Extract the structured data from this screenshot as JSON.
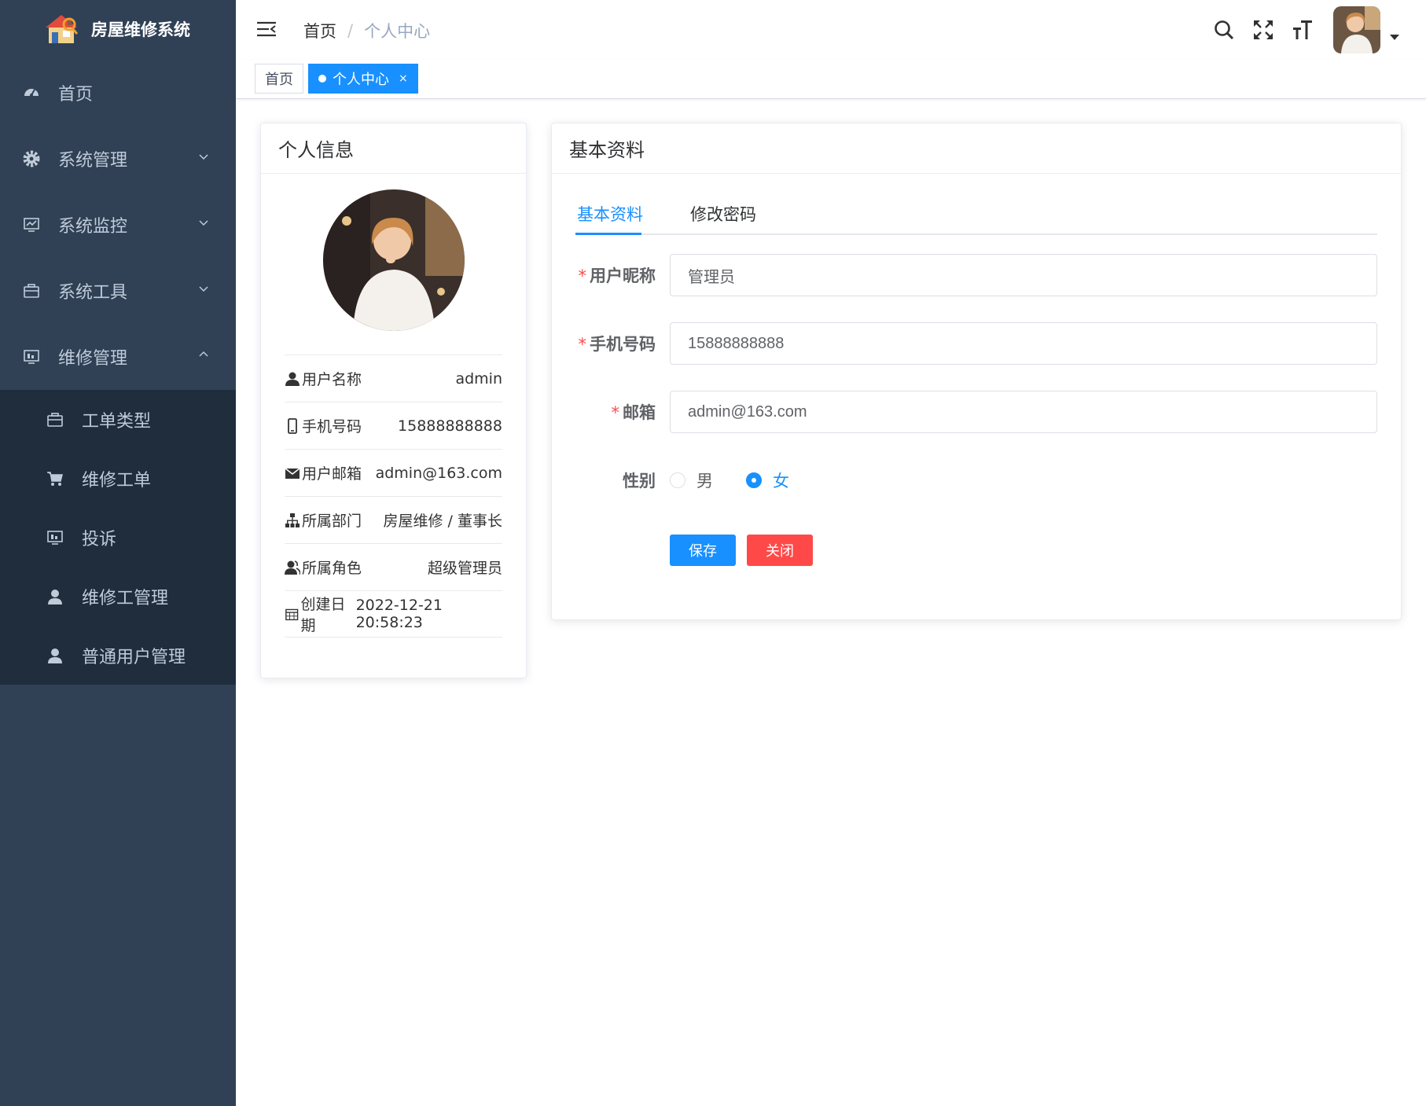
{
  "app": {
    "title": "房屋维修系统"
  },
  "sidebar": {
    "items": [
      {
        "label": "首页",
        "icon": "dashboard-icon"
      },
      {
        "label": "系统管理",
        "icon": "gear-icon"
      },
      {
        "label": "系统监控",
        "icon": "monitor-icon"
      },
      {
        "label": "系统工具",
        "icon": "toolbox-icon"
      },
      {
        "label": "维修管理",
        "icon": "monitor-icon"
      }
    ],
    "sub_items": [
      {
        "label": "工单类型",
        "icon": "toolbox-icon"
      },
      {
        "label": "维修工单",
        "icon": "cart-icon"
      },
      {
        "label": "投诉",
        "icon": "monitor-icon"
      },
      {
        "label": "维修工管理",
        "icon": "user-icon"
      },
      {
        "label": "普通用户管理",
        "icon": "user-icon"
      }
    ]
  },
  "header": {
    "breadcrumb": [
      "首页",
      "个人中心"
    ],
    "separator": "/"
  },
  "tags": {
    "home": "首页",
    "current": "个人中心",
    "close": "×"
  },
  "profile_card": {
    "title": "个人信息",
    "rows": [
      {
        "label": "用户名称",
        "value": "admin"
      },
      {
        "label": "手机号码",
        "value": "15888888888"
      },
      {
        "label": "用户邮箱",
        "value": "admin@163.com"
      },
      {
        "label": "所属部门",
        "value": "房屋维修 / 董事长"
      },
      {
        "label": "所属角色",
        "value": "超级管理员"
      },
      {
        "label": "创建日期",
        "value": "2022-12-21 20:58:23"
      }
    ]
  },
  "basic_card": {
    "title": "基本资料",
    "tabs": [
      "基本资料",
      "修改密码"
    ],
    "required_mark": "*",
    "fields": {
      "nickname": {
        "label": "用户昵称",
        "value": "管理员"
      },
      "phone": {
        "label": "手机号码",
        "value": "15888888888"
      },
      "email": {
        "label": "邮箱",
        "value": "admin@163.com"
      },
      "gender": {
        "label": "性别",
        "options": [
          "男",
          "女"
        ],
        "selected": "女"
      }
    },
    "buttons": {
      "save": "保存",
      "close": "关闭"
    }
  },
  "colors": {
    "sidebar": "#304156",
    "submenu": "#1f2d3d",
    "primary": "#1890ff",
    "danger": "#ff4949"
  }
}
